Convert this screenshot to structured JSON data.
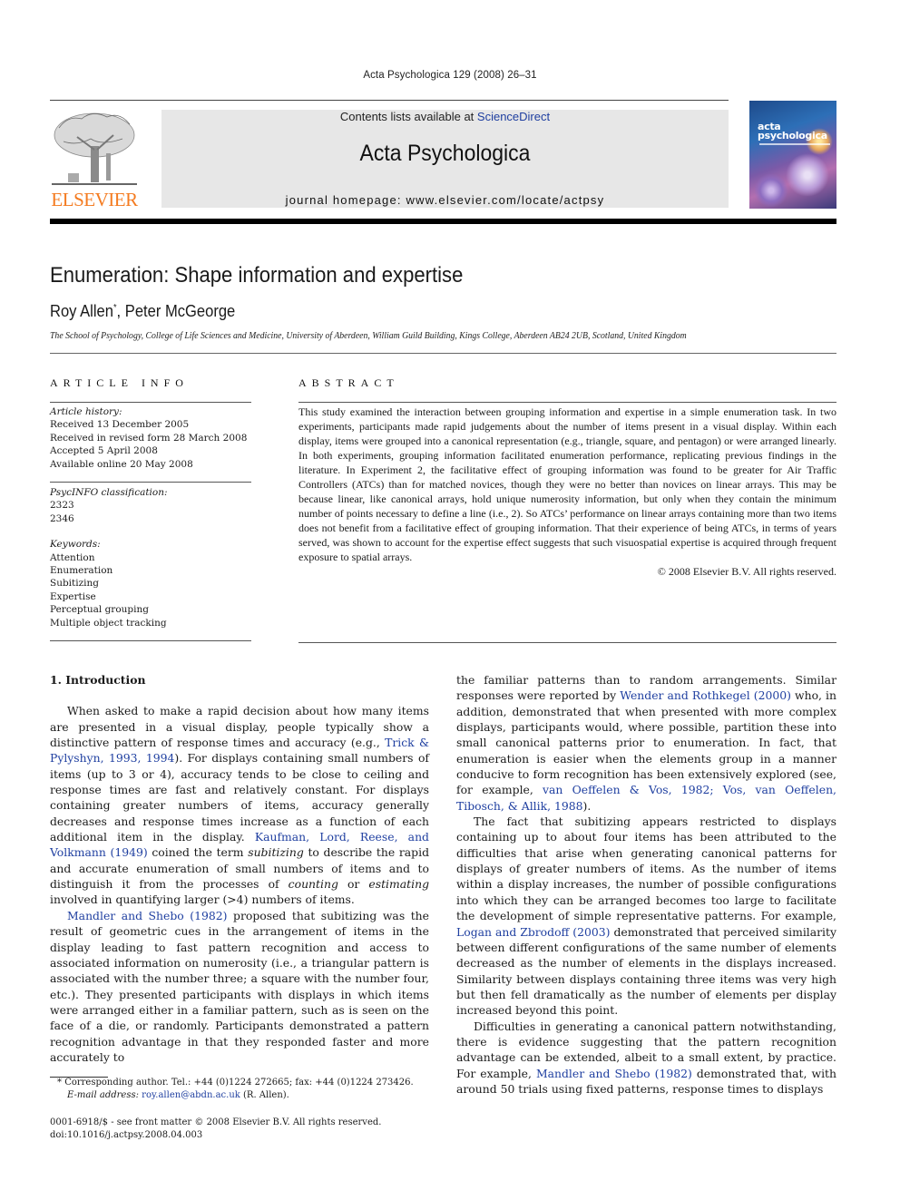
{
  "running_head": "Acta Psychologica 129 (2008) 26–31",
  "masthead": {
    "publisher_logo_text": "ELSEVIER",
    "contents_prefix": "Contents lists available at ",
    "contents_link": "ScienceDirect",
    "journal_name": "Acta Psychologica",
    "homepage": "journal homepage: www.elsevier.com/locate/actpsy",
    "cover_title_line1": "acta",
    "cover_title_line2": "psychologica",
    "brand_color": "#f47b20",
    "link_color": "#1f3fa0"
  },
  "article": {
    "title": "Enumeration: Shape information and expertise",
    "authors": [
      {
        "name": "Roy Allen",
        "mark": "*"
      },
      {
        "name": "Peter McGeorge",
        "mark": ""
      }
    ],
    "author_separator": ", ",
    "affiliation": "The School of Psychology, College of Life Sciences and Medicine, University of Aberdeen, William Guild Building, Kings College, Aberdeen AB24 2UB, Scotland, United Kingdom"
  },
  "article_info": {
    "heading": "ARTICLE INFO",
    "history_label": "Article history:",
    "history": [
      "Received 13 December 2005",
      "Received in revised form 28 March 2008",
      "Accepted 5 April 2008",
      "Available online 20 May 2008"
    ],
    "classification_label": "PsycINFO classification:",
    "classification": [
      "2323",
      "2346"
    ],
    "keywords_label": "Keywords:",
    "keywords": [
      "Attention",
      "Enumeration",
      "Subitizing",
      "Expertise",
      "Perceptual grouping",
      "Multiple object tracking"
    ]
  },
  "abstract": {
    "heading": "ABSTRACT",
    "text": "This study examined the interaction between grouping information and expertise in a simple enumeration task. In two experiments, participants made rapid judgements about the number of items present in a visual display. Within each display, items were grouped into a canonical representation (e.g., triangle, square, and pentagon) or were arranged linearly. In both experiments, grouping information facilitated enumeration performance, replicating previous findings in the literature. In Experiment 2, the facilitative effect of grouping information was found to be greater for Air Traffic Controllers (ATCs) than for matched novices, though they were no better than novices on linear arrays. This may be because linear, like canonical arrays, hold unique numerosity information, but only when they contain the minimum number of points necessary to define a line (i.e., 2). So ATCs’ performance on linear arrays containing more than two items does not benefit from a facilitative effect of grouping information. That their experience of being ATCs, in terms of years served, was shown to account for the expertise effect suggests that such visuospatial expertise is acquired through frequent exposure to spatial arrays.",
    "copyright": "© 2008 Elsevier B.V. All rights reserved."
  },
  "body": {
    "section_heading": "1. Introduction",
    "left": {
      "p1": [
        {
          "t": "When asked to make a rapid decision about how many items are presented in a visual display, people typically show a distinctive pattern of response times and accuracy (e.g., "
        },
        {
          "t": "Trick & Pylyshyn, 1993, 1994",
          "link": true
        },
        {
          "t": "). For displays containing small numbers of items (up to 3 or 4), accuracy tends to be close to ceiling and response times are fast and relatively constant. For displays containing greater numbers of items, accuracy generally decreases and response times increase as a function of each additional item in the display. "
        },
        {
          "t": "Kaufman, Lord, Reese, and Volkmann (1949)",
          "link": true
        },
        {
          "t": " coined the term "
        },
        {
          "t": "subitizing",
          "em": true
        },
        {
          "t": " to describe the rapid and accurate enumeration of small numbers of items and to distinguish it from the processes of "
        },
        {
          "t": "counting",
          "em": true
        },
        {
          "t": " or "
        },
        {
          "t": "estimating",
          "em": true
        },
        {
          "t": " involved in quantifying larger (>4) numbers of items."
        }
      ],
      "p2": [
        {
          "t": "Mandler and Shebo (1982)",
          "link": true
        },
        {
          "t": " proposed that subitizing was the result of geometric cues in the arrangement of items in the display leading to fast pattern recognition and access to associated information on numerosity (i.e., a triangular pattern is associated with the number three; a square with the number four, etc.). They presented participants with displays in which items were arranged either in a familiar pattern, such as is seen on the face of a die, or randomly. Participants demonstrated a pattern recognition advantage in that they responded faster and more accurately to"
        }
      ]
    },
    "right": {
      "p1": [
        {
          "t": "the familiar patterns than to random arrangements. Similar responses were reported by "
        },
        {
          "t": "Wender and Rothkegel (2000)",
          "link": true
        },
        {
          "t": " who, in addition, demonstrated that when presented with more complex displays, participants would, where possible, partition these into small canonical patterns prior to enumeration. In fact, that enumeration is easier when the elements group in a manner conducive to form recognition has been extensively explored (see, for example, "
        },
        {
          "t": "van Oeffelen & Vos, 1982; Vos, van Oeffelen, Tibosch, & Allik, 1988",
          "link": true
        },
        {
          "t": ")."
        }
      ],
      "p2": [
        {
          "t": "The fact that subitizing appears restricted to displays containing up to about four items has been attributed to the difficulties that arise when generating canonical patterns for displays of greater numbers of items. As the number of items within a display increases, the number of possible configurations into which they can be arranged becomes too large to facilitate the development of simple representative patterns. For example, "
        },
        {
          "t": "Logan and Zbrodoff (2003)",
          "link": true
        },
        {
          "t": " demonstrated that perceived similarity between different configurations of the same number of elements decreased as the number of elements in the displays increased. Similarity between displays containing three items was very high but then fell dramatically as the number of elements per display increased beyond this point."
        }
      ],
      "p3": [
        {
          "t": "Difficulties in generating a canonical pattern notwithstanding, there is evidence suggesting that the pattern recognition advantage can be extended, albeit to a small extent, by practice. For example, "
        },
        {
          "t": "Mandler and Shebo (1982)",
          "link": true
        },
        {
          "t": " demonstrated that, with around 50 trials using fixed patterns, response times to displays"
        }
      ]
    }
  },
  "footnote": {
    "mark": "*",
    "corresponding": "Corresponding author. Tel.: +44 (0)1224 272665; fax: +44 (0)1224 273426.",
    "email_label": "E-mail address:",
    "email": "roy.allen@abdn.ac.uk",
    "email_suffix": " (R. Allen)."
  },
  "front_matter": {
    "issn_line": "0001-6918/$ - see front matter © 2008 Elsevier B.V. All rights reserved.",
    "doi": "doi:10.1016/j.actpsy.2008.04.003"
  }
}
